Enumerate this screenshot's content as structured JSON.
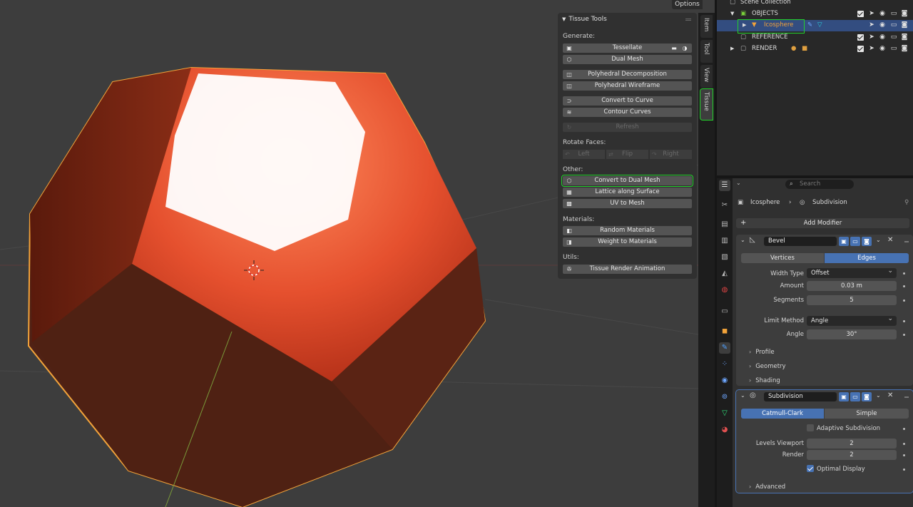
{
  "viewport": {
    "options_label": "Options",
    "colors": {
      "background": "#3d3d3d",
      "object_outline": "#f2a33a",
      "object_base": "#8a2a14",
      "object_face": "#e6593a",
      "highlight": "#ffffff"
    }
  },
  "tissue_panel": {
    "title": "Tissue Tools",
    "sections": {
      "generate": "Generate:",
      "rotate": "Rotate Faces:",
      "other": "Other:",
      "materials": "Materials:",
      "utils": "Utils:"
    },
    "buttons": {
      "tessellate": "Tessellate",
      "dual_mesh": "Dual Mesh",
      "polyhedral_decomposition": "Polyhedral Decomposition",
      "polyhedral_wireframe": "Polyhedral Wireframe",
      "convert_to_curve": "Convert to Curve",
      "contour_curves": "Contour Curves",
      "refresh": "Refresh",
      "rotate_left": "Left",
      "rotate_flip": "Flip",
      "rotate_right": "Right",
      "convert_to_dual_mesh": "Convert to Dual Mesh",
      "lattice_along_surface": "Lattice along Surface",
      "uv_to_mesh": "UV to Mesh",
      "random_materials": "Random Materials",
      "weight_to_materials": "Weight to Materials",
      "tissue_render_animation": "Tissue Render Animation"
    }
  },
  "side_tabs": [
    "Item",
    "Tool",
    "View",
    "Tissue"
  ],
  "outliner": {
    "root": "Scene Collection",
    "rows": [
      {
        "label": "OBJECTS"
      },
      {
        "label": "Icosphere"
      },
      {
        "label": "REFERENCE"
      },
      {
        "label": "RENDER"
      }
    ]
  },
  "properties": {
    "search_placeholder": "Search",
    "breadcrumb": {
      "object": "Icosphere",
      "modifier": "Subdivision"
    },
    "add_modifier": "Add Modifier",
    "bevel": {
      "name": "Bevel",
      "mode_options": [
        "Vertices",
        "Edges"
      ],
      "mode_selected": "Edges",
      "width_type_label": "Width Type",
      "width_type": "Offset",
      "amount_label": "Amount",
      "amount": "0.03 m",
      "segments_label": "Segments",
      "segments": "5",
      "limit_method_label": "Limit Method",
      "limit_method": "Angle",
      "angle_label": "Angle",
      "angle": "30°",
      "subpanels": [
        "Profile",
        "Geometry",
        "Shading"
      ]
    },
    "subdivision": {
      "name": "Subdivision",
      "algo_options": [
        "Catmull-Clark",
        "Simple"
      ],
      "algo_selected": "Catmull-Clark",
      "adaptive_label": "Adaptive Subdivision",
      "adaptive": false,
      "levels_viewport_label": "Levels Viewport",
      "levels_viewport": "2",
      "render_label": "Render",
      "render": "2",
      "optimal_display_label": "Optimal Display",
      "optimal_display": true,
      "advanced_label": "Advanced"
    }
  }
}
